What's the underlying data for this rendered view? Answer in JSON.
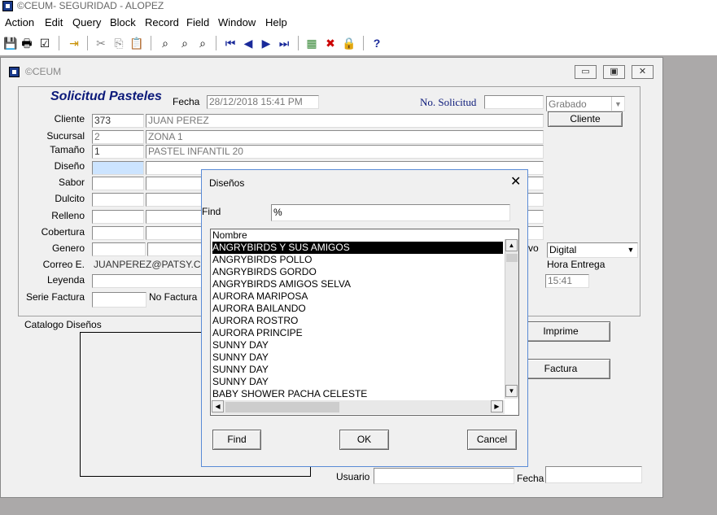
{
  "app": {
    "title": "©CEUM- SEGURIDAD - ALOPEZ"
  },
  "menu": [
    "Action",
    "Edit",
    "Query",
    "Block",
    "Record",
    "Field",
    "Window",
    "Help"
  ],
  "window": {
    "title": "©CEUM"
  },
  "form": {
    "title": "Solicitud Pasteles",
    "fecha_label": "Fecha",
    "fecha_value": "28/12/2018 15:41 PM",
    "no_solicitud_label": "No. Solicitud",
    "no_solicitud_value": "",
    "status_value": "Grabado",
    "cliente_button": "Cliente",
    "cliente_label": "Cliente",
    "cliente_code": "373",
    "cliente_name": "JUAN PEREZ",
    "sucursal_label": "Sucursal",
    "sucursal_code": "2",
    "sucursal_name": "ZONA 1",
    "tamano_label": "Tamaño",
    "tamano_code": "1",
    "tamano_name": "PASTEL INFANTIL 20",
    "diseno_label": "Diseño",
    "sabor_label": "Sabor",
    "dulcito_label": "Dulcito",
    "relleno_label": "Relleno",
    "cobertura_label": "Cobertura",
    "genero_label": "Genero",
    "correo_label": "Correo E.",
    "correo_value": "JUANPEREZ@PATSY.COM",
    "leyenda_label": "Leyenda",
    "serie_factura_label": "Serie Factura",
    "no_factura_label": "No Factura",
    "tipo_partial": "vo",
    "tipo_value": "Digital",
    "hora_entrega_label": "Hora Entrega",
    "hora_entrega_value": "15:41"
  },
  "lower": {
    "catalogo_label": "Catalogo Diseños",
    "imprime_button": "Imprime",
    "factura_button": "Factura",
    "usuario_label": "Usuario",
    "fecha_label": "Fecha"
  },
  "dialog": {
    "title": "Diseños",
    "find_label": "Find",
    "find_value": "%",
    "column_header": "Nombre",
    "items": [
      "ANGRYBIRDS Y SUS AMIGOS",
      "ANGRYBIRDS POLLO",
      "ANGRYBIRDS GORDO",
      "ANGRYBIRDS AMIGOS SELVA",
      "AURORA MARIPOSA",
      "AURORA BAILANDO",
      "AURORA ROSTRO",
      "AURORA PRINCIPE",
      "SUNNY DAY",
      "SUNNY DAY",
      "SUNNY DAY",
      "SUNNY DAY",
      "BABY SHOWER PACHA CELESTE"
    ],
    "selected_index": 0,
    "find_button": "Find",
    "ok_button": "OK",
    "cancel_button": "Cancel"
  }
}
